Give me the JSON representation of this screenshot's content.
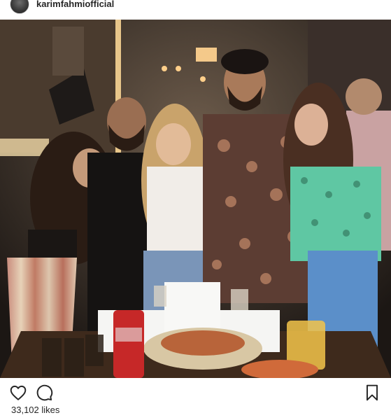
{
  "post": {
    "username": "karimfahmiofficial",
    "likes_text": "33,102 likes"
  },
  "icons": {
    "avatar": "profile-avatar",
    "like": "heart-outline-icon",
    "comment": "comment-bubble-icon",
    "save": "bookmark-outline-icon"
  },
  "colors": {
    "text": "#262626",
    "icon_stroke": "#262626",
    "border": "#dbdbdb"
  }
}
